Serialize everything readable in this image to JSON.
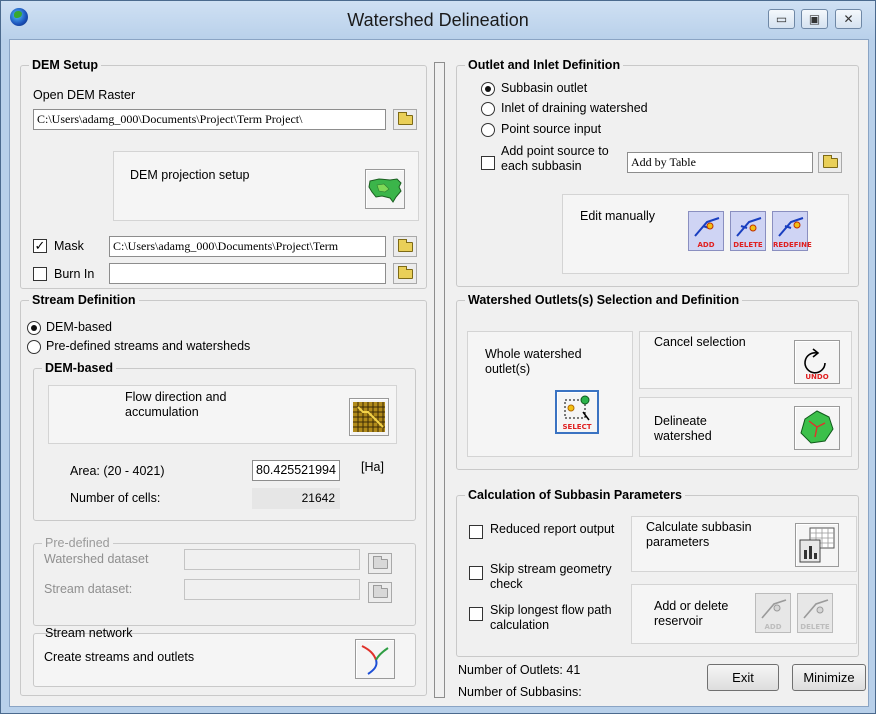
{
  "window": {
    "title": "Watershed Delineation",
    "controls": {
      "minimize": "▭",
      "maximize": "▣",
      "close": "✕"
    }
  },
  "dem_setup": {
    "title": "DEM Setup",
    "open_label": "Open DEM Raster",
    "dem_path": "C:\\Users\\adamg_000\\Documents\\Project\\Term Project\\",
    "projection_label": "DEM projection setup",
    "mask_label": "Mask",
    "mask_checked": true,
    "mask_path": "C:\\Users\\adamg_000\\Documents\\Project\\Term",
    "burnin_label": "Burn In",
    "burnin_checked": false,
    "burnin_path": ""
  },
  "stream_definition": {
    "title": "Stream Definition",
    "radio_dem": "DEM-based",
    "radio_predefined": "Pre-defined streams and watersheds",
    "selected": "DEM-based",
    "dem_based": {
      "title": "DEM-based",
      "flow_label": "Flow direction and accumulation",
      "area_label": "Area: (20 - 4021)",
      "area_value": "80.425521994",
      "area_unit": "[Ha]",
      "cells_label": "Number of cells:",
      "cells_value": "21642"
    },
    "pre_defined": {
      "title": "Pre-defined",
      "watershed_label": "Watershed dataset",
      "stream_label": "Stream dataset:"
    },
    "stream_network": {
      "title": "Stream network",
      "label": "Create streams and outlets"
    }
  },
  "outlet_inlet": {
    "title": "Outlet and Inlet Definition",
    "options": [
      "Subbasin outlet",
      "Inlet of draining watershed",
      "Point source input"
    ],
    "selected": "Subbasin outlet",
    "add_point_label": "Add point source to each subbasin",
    "add_point_checked": false,
    "add_by_value": "Add by Table",
    "edit_label": "Edit manually",
    "edit_tools": [
      "ADD",
      "DELETE",
      "REDEFINE"
    ]
  },
  "outlet_selection": {
    "title": "Watershed Outlets(s) Selection and Definition",
    "whole_label": "Whole watershed outlet(s)",
    "select_tool": "SELECT",
    "cancel_label": "Cancel selection",
    "undo_tool": "UNDO",
    "delineate_label": "Delineate watershed"
  },
  "subbasin_params": {
    "title": "Calculation of Subbasin Parameters",
    "checks": [
      {
        "label": "Reduced report output",
        "checked": false
      },
      {
        "label": "Skip stream geometry check",
        "checked": false
      },
      {
        "label": "Skip longest flow path calculation",
        "checked": false
      }
    ],
    "calc_label": "Calculate subbasin parameters",
    "reservoir_label": "Add or delete reservoir",
    "reservoir_tools": [
      "ADD",
      "DELETE"
    ]
  },
  "footer": {
    "outlets_label": "Number of Outlets: 41",
    "subbasins_label": "Number of Subbasins:",
    "exit_label": "Exit",
    "minimize_label": "Minimize"
  },
  "colors": {
    "title_bar": "#b8d0ea",
    "dialog_bg": "#f0f0f0",
    "edit_tool_bg": "#cfd4f4",
    "tool_caption": "#e02020",
    "select_border": "#3a73c2"
  }
}
